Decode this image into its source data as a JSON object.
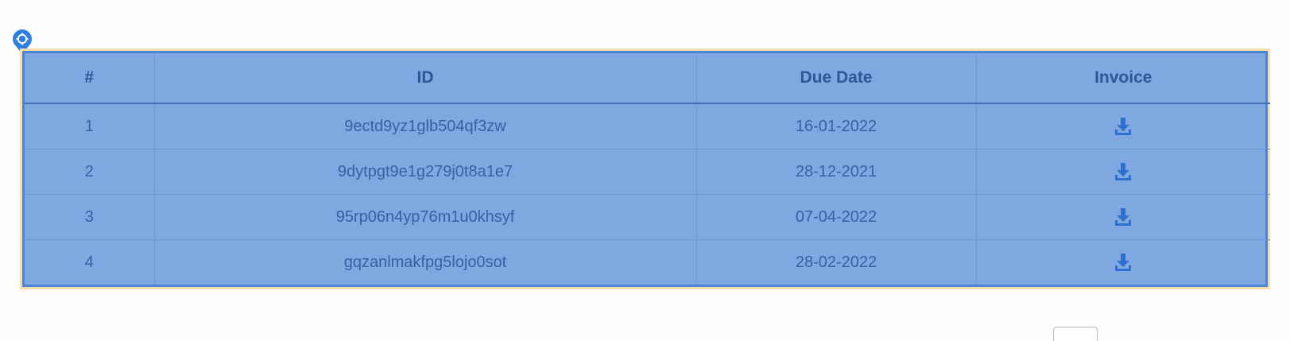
{
  "table": {
    "headers": {
      "index": "#",
      "id": "ID",
      "due_date": "Due Date",
      "invoice": "Invoice"
    },
    "rows": [
      {
        "index": "1",
        "id": "9ectd9yz1glb504qf3zw",
        "due_date": "16-01-2022",
        "invoice_icon": "download-icon"
      },
      {
        "index": "2",
        "id": "9dytpgt9e1g279j0t8a1e7",
        "due_date": "28-12-2021",
        "invoice_icon": "download-icon"
      },
      {
        "index": "3",
        "id": "95rp06n4yp76m1u0khsyf",
        "due_date": "07-04-2022",
        "invoice_icon": "download-icon"
      },
      {
        "index": "4",
        "id": "gqzanlmakfpg5lojo0sot",
        "due_date": "28-02-2022",
        "invoice_icon": "download-icon"
      }
    ]
  },
  "colors": {
    "highlight_fill": "#7ea8df",
    "highlight_border": "#4a86d8",
    "outer_border": "#f6dca8",
    "text": "#2f5f9e",
    "icon": "#2f6fd0"
  },
  "locator_icon": "crosshair-pin-icon"
}
